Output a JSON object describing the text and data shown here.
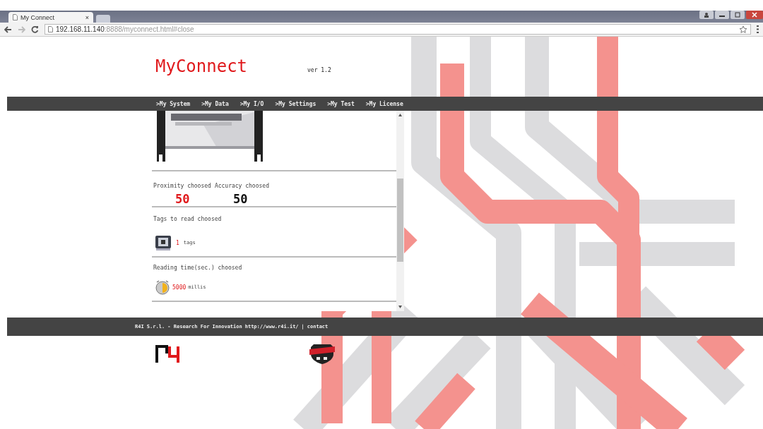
{
  "browser": {
    "tab_title": "My Connect",
    "tab_close": "×",
    "url_host": "192.168.11.140",
    "url_rest": ":8888/myconnect.html#close"
  },
  "header": {
    "title": "MyConnect",
    "version": "ver 1.2"
  },
  "nav": [
    {
      "label": ">My System"
    },
    {
      "label": ">My Data"
    },
    {
      "label": ">My I/O"
    },
    {
      "label": ">My Settings"
    },
    {
      "label": ">My Test"
    },
    {
      "label": ">My License"
    }
  ],
  "content": {
    "proximity_label": "Proximity choosed",
    "accuracy_label": "Accuracy choosed",
    "proximity_value": "50",
    "accuracy_value": "50",
    "tags_label": "Tags to read choosed",
    "tags_count": "1",
    "tags_unit": "tags",
    "reading_label": "Reading time(sec.) choosed",
    "reading_value": "5000",
    "reading_unit": "millis"
  },
  "footer": {
    "company": "R4I S.r.l. - Research For Innovation",
    "link": "http://www.r4i.it/",
    "separator": "|",
    "contact": "contact"
  }
}
